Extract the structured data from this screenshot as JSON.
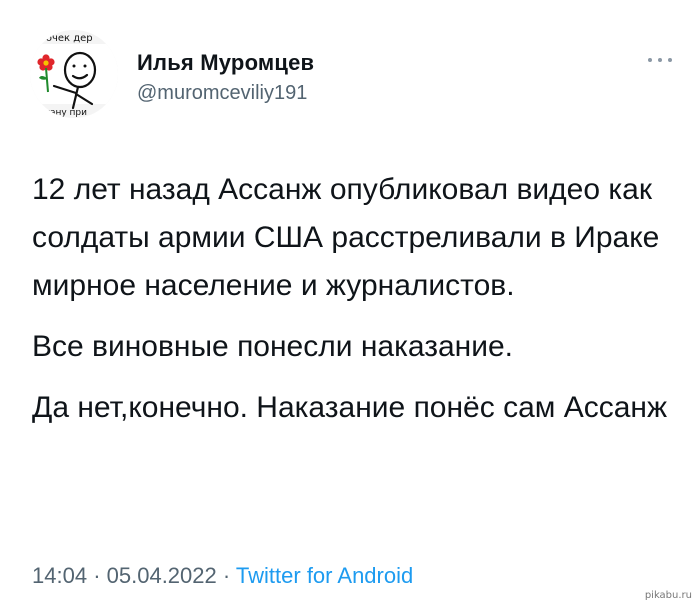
{
  "user": {
    "display_name": "Илья Муромцев",
    "handle": "@muromceviliy191",
    "avatar_label_top": "точек дер",
    "avatar_label_bottom": "аргану при"
  },
  "tweet": {
    "paragraphs": [
      "12 лет назад Ассанж опубликовал видео как солдаты армии США расстреливали в Ираке мирное население и журналистов.",
      "Все виновные понесли наказание.",
      "Да нет,конечно. Наказание понёс сам Ассанж"
    ]
  },
  "meta": {
    "time": "14:04",
    "separator": "·",
    "date": "05.04.2022",
    "source": "Twitter for Android"
  },
  "watermark": "pikabu.ru",
  "colors": {
    "text": "#0f1419",
    "secondary": "#536471",
    "link": "#1d9bf0",
    "flower": "#e0262b"
  }
}
